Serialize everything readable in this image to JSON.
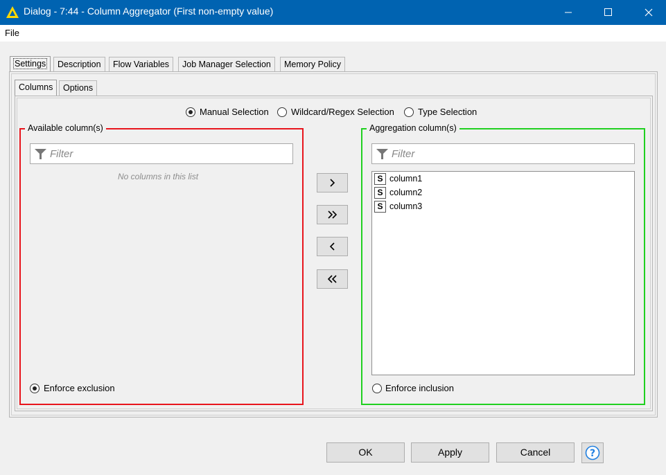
{
  "window": {
    "title": "Dialog - 7:44 - Column Aggregator (First non-empty value)",
    "accent": "#0063b1"
  },
  "menu": {
    "file": "File"
  },
  "outer_tabs": [
    "Settings",
    "Description",
    "Flow Variables",
    "Job Manager Selection",
    "Memory Policy"
  ],
  "inner_tabs": [
    "Columns",
    "Options"
  ],
  "selection_mode": {
    "options": [
      "Manual Selection",
      "Wildcard/Regex Selection",
      "Type Selection"
    ],
    "selected": "Manual Selection"
  },
  "available": {
    "title": "Available column(s)",
    "filter_placeholder": "Filter",
    "empty_message": "No columns in this list",
    "enforce_label": "Enforce exclusion",
    "enforce_selected": true,
    "border_color": "#e8141c"
  },
  "aggregation": {
    "title": "Aggregation column(s)",
    "filter_placeholder": "Filter",
    "columns": [
      {
        "type": "S",
        "name": "column1"
      },
      {
        "type": "S",
        "name": "column2"
      },
      {
        "type": "S",
        "name": "column3"
      }
    ],
    "enforce_label": "Enforce inclusion",
    "enforce_selected": false,
    "border_color": "#20d020"
  },
  "move_buttons": [
    "add-icon",
    "add-all-icon",
    "remove-icon",
    "remove-all-icon"
  ],
  "buttons": {
    "ok": "OK",
    "apply": "Apply",
    "cancel": "Cancel"
  }
}
